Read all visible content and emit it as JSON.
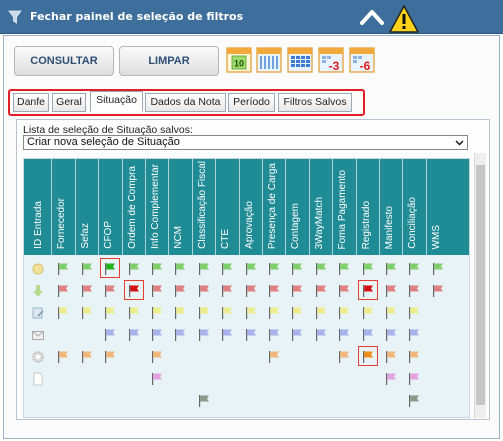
{
  "header": {
    "title": "Fechar painel de seleção de filtros",
    "funnel_icon": "funnel-icon",
    "collapse_icon": "chevron-up-icon",
    "warning_icon": "warning-icon"
  },
  "toolbar": {
    "consultar_label": "CONSULTAR",
    "limpar_label": "LIMPAR",
    "calendar_buttons": [
      {
        "name": "calendar-day-icon",
        "text": "10"
      },
      {
        "name": "calendar-week-icon",
        "text": ""
      },
      {
        "name": "calendar-month-icon",
        "text": ""
      },
      {
        "name": "calendar-minus3-icon",
        "text": "-3"
      },
      {
        "name": "calendar-minus6-icon",
        "text": "-6"
      }
    ]
  },
  "tabs": [
    {
      "label": "Danfe",
      "active": false
    },
    {
      "label": "Geral",
      "active": false
    },
    {
      "label": "Situação",
      "active": true
    },
    {
      "label": "Dados da Nota",
      "active": false
    },
    {
      "label": "Período",
      "active": false
    },
    {
      "label": "Filtros Salvos",
      "active": false
    }
  ],
  "situacao": {
    "list_label": "Lista de seleção de Situação salvos:",
    "select_value": "Criar nova seleção de Situação",
    "columns": [
      "ID Entrada",
      "Fornecedor",
      "Sefaz",
      "CFOP",
      "Ordem de Compra",
      "Info Complementar",
      "NCM",
      "Classificação Fiscal",
      "CTE",
      "Aprovação",
      "Presença de Carga",
      "Contagem",
      "3WayMatch",
      "Foma Pagamento",
      "Registrado",
      "Manifesto",
      "Conciliação",
      "WMS"
    ],
    "rows": [
      {
        "icon": "sun-status-icon",
        "flag_color": "#7fcf6b",
        "cells": [
          1,
          1,
          1,
          1,
          1,
          1,
          1,
          1,
          1,
          1,
          1,
          1,
          1,
          1,
          1,
          1,
          1
        ],
        "selected": [
          3
        ]
      },
      {
        "icon": "arrow-down-status-icon",
        "flag_color": "#e08080",
        "cells": [
          1,
          1,
          1,
          1,
          1,
          1,
          1,
          1,
          1,
          1,
          1,
          1,
          1,
          1,
          1,
          1,
          1
        ],
        "selected": [
          4,
          14
        ]
      },
      {
        "icon": "doc-edit-status-icon",
        "flag_color": "#eded90",
        "cells": [
          1,
          1,
          1,
          1,
          1,
          1,
          1,
          1,
          1,
          1,
          1,
          1,
          1,
          1,
          1,
          1,
          0
        ],
        "selected": []
      },
      {
        "icon": "envelope-status-icon",
        "flag_color": "#a7b2ea",
        "cells": [
          0,
          0,
          1,
          1,
          1,
          1,
          1,
          1,
          1,
          1,
          1,
          1,
          1,
          1,
          1,
          1,
          0
        ],
        "selected": []
      },
      {
        "icon": "gear-status-icon",
        "flag_color": "#f2b57a",
        "cells": [
          1,
          1,
          1,
          0,
          1,
          0,
          0,
          0,
          0,
          1,
          0,
          0,
          1,
          1,
          1,
          1,
          0
        ],
        "selected": [
          4,
          14
        ]
      },
      {
        "icon": "page-status-icon",
        "flag_color": "#e0a3e0",
        "cells": [
          0,
          0,
          0,
          0,
          1,
          0,
          0,
          0,
          0,
          0,
          0,
          0,
          0,
          0,
          1,
          1,
          0
        ],
        "selected": []
      },
      {
        "icon": "blank-status-icon",
        "flag_color": "#8a9a8a",
        "cells": [
          0,
          0,
          0,
          0,
          0,
          0,
          1,
          0,
          0,
          0,
          0,
          0,
          0,
          0,
          0,
          1,
          0
        ],
        "selected": []
      }
    ],
    "selected_flag_colors": {
      "0": "#21b21d",
      "1": "#d30f0f",
      "4": "#f28a1a"
    }
  }
}
